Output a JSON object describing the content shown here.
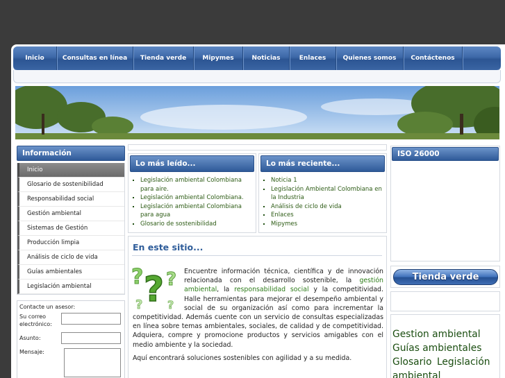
{
  "nav": {
    "items": [
      "Inicio",
      "Consultas en línea",
      "Tienda verde",
      "Mipymes",
      "Noticias",
      "Enlaces",
      "Quienes somos",
      "Contáctenos"
    ]
  },
  "sidebar": {
    "title": "Información",
    "items": [
      "Inicio",
      "Glosario de sostenibilidad",
      "Responsabilidad social",
      "Gestión ambiental",
      "Sistemas de Gestión",
      "Producción limpia",
      "Análisis de ciclo de vida",
      "Guías ambientales",
      "Legislación ambiental"
    ],
    "active_index": 0
  },
  "contact": {
    "title": "Contacte un asesor:",
    "email_label": "Su correo electrónico:",
    "subject_label": "Asunto:",
    "message_label": "Mensaje:"
  },
  "most_read": {
    "title": "Lo más leído...",
    "items": [
      "Legislación ambiental Colombiana para aire.",
      "Legislación ambiental Colombiana.",
      "Legislación ambiental Colombiana para agua",
      "Glosario de sostenibilidad"
    ]
  },
  "most_recent": {
    "title": "Lo más reciente...",
    "items": [
      "Noticia 1",
      "Legislación Ambiental Colombiana en la Industria",
      "Análisis de ciclo de vida",
      "Enlaces",
      "Mipymes"
    ]
  },
  "site": {
    "title": "En este sitio...",
    "p1_a": "Encuentre información técnica, científica y de innovación relacionada con el desarrollo sostenible, la ",
    "link_gestion": "gestión ambiental",
    "p1_b": ", la ",
    "link_resp": "responsabilidad social",
    "p1_c": " y la competitividad. Halle herramientas para mejorar el desempeño ambiental y social de su organización así como para incrementar la competitividad. Además cuente con un servicio de consultas especializadas en línea sobre temas ambientales, sociales, de calidad y de competitividad. Adquiera, compre y promocione productos y servicios amigables con el medio ambiente y la sociedad.",
    "p2": "Aquí encontrará soluciones sostenibles con agilidad y a su medida."
  },
  "right": {
    "iso_title": "ISO 26000",
    "store_button": "Tienda verde",
    "tags": [
      "Gestion ambiental",
      "Guías ambientales",
      "Glosario",
      "Legislación ambiental"
    ]
  },
  "colors": {
    "page_bg": "#3b3b3b",
    "nav_blue": "#3d68a8",
    "heading_blue": "#2f5d9a",
    "link_green": "#2f7d1b"
  }
}
